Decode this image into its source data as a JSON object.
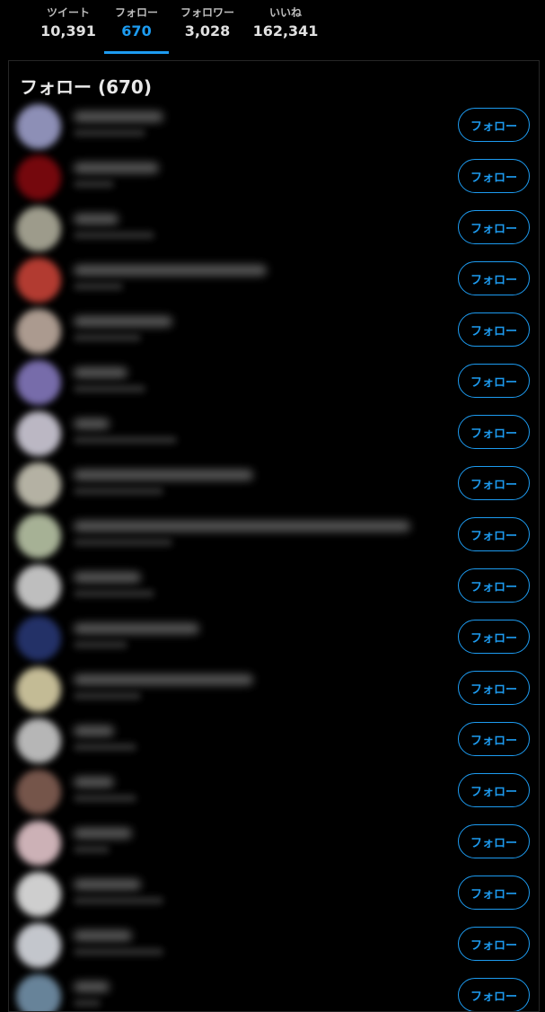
{
  "tabs": [
    {
      "label": "ツイート",
      "count": "10,391"
    },
    {
      "label": "フォロー",
      "count": "670"
    },
    {
      "label": "フォロワー",
      "count": "3,028"
    },
    {
      "label": "いいね",
      "count": "162,341"
    }
  ],
  "active_tab": "フォロー",
  "panel": {
    "title": "フォロー (670)"
  },
  "follow_button_label": "フォロー",
  "colors": {
    "accent": "#1d9bf0",
    "background": "#000000",
    "border": "#262626"
  },
  "users": [
    {
      "avatar_color": "#a6a8d6"
    },
    {
      "avatar_color": "#8a0a10"
    },
    {
      "avatar_color": "#b9b7a4"
    },
    {
      "avatar_color": "#d2463a"
    },
    {
      "avatar_color": "#c9b5a8"
    },
    {
      "avatar_color": "#8c7fc8"
    },
    {
      "avatar_color": "#dcd8e6"
    },
    {
      "avatar_color": "#d4d1c0"
    },
    {
      "avatar_color": "#c4d0b0"
    },
    {
      "avatar_color": "#e0e0e0"
    },
    {
      "avatar_color": "#2a3a7a"
    },
    {
      "avatar_color": "#e6dcb0"
    },
    {
      "avatar_color": "#d6d6d6"
    },
    {
      "avatar_color": "#8a6458"
    },
    {
      "avatar_color": "#f0d0d6"
    },
    {
      "avatar_color": "#f2f2f2"
    },
    {
      "avatar_color": "#e6e9f0"
    },
    {
      "avatar_color": "#7a9ab4"
    }
  ]
}
